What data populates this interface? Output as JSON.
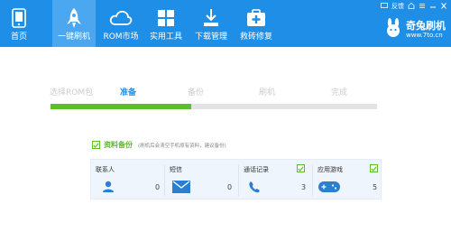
{
  "app": {
    "brand_name": "奇兔刷机",
    "brand_url": "www.7to.cn",
    "feedback_label": "反馈"
  },
  "nav": [
    {
      "label": "首页",
      "icon": "phone-icon"
    },
    {
      "label": "一键刷机",
      "icon": "rocket-icon"
    },
    {
      "label": "ROM市场",
      "icon": "cloud-icon"
    },
    {
      "label": "实用工具",
      "icon": "grid-icon"
    },
    {
      "label": "下载管理",
      "icon": "download-icon"
    },
    {
      "label": "救砖修复",
      "icon": "medkit-icon"
    }
  ],
  "steps": [
    "选择ROM包",
    "准备",
    "备份",
    "刷机",
    "完成"
  ],
  "progress": {
    "fraction": 0.43
  },
  "backup": {
    "title": "资料备份",
    "note": "(刷机后会清空手机原有资料，建议备份)",
    "checked": true
  },
  "items": [
    {
      "name": "联系人",
      "count": "0",
      "icon": "contact-icon"
    },
    {
      "name": "短信",
      "count": "0",
      "icon": "sms-icon"
    },
    {
      "name": "通话记录",
      "count": "3",
      "icon": "call-icon",
      "checked": true
    },
    {
      "name": "应用游戏",
      "count": "5",
      "icon": "gamepad-icon",
      "checked": true
    }
  ],
  "colors": {
    "topbar": "#1e8ee6",
    "nav_active": "#4aa7f0",
    "accent_green": "#5bbf2a",
    "step_active": "#1e8ee6",
    "icon_blue": "#2a7fd0"
  }
}
